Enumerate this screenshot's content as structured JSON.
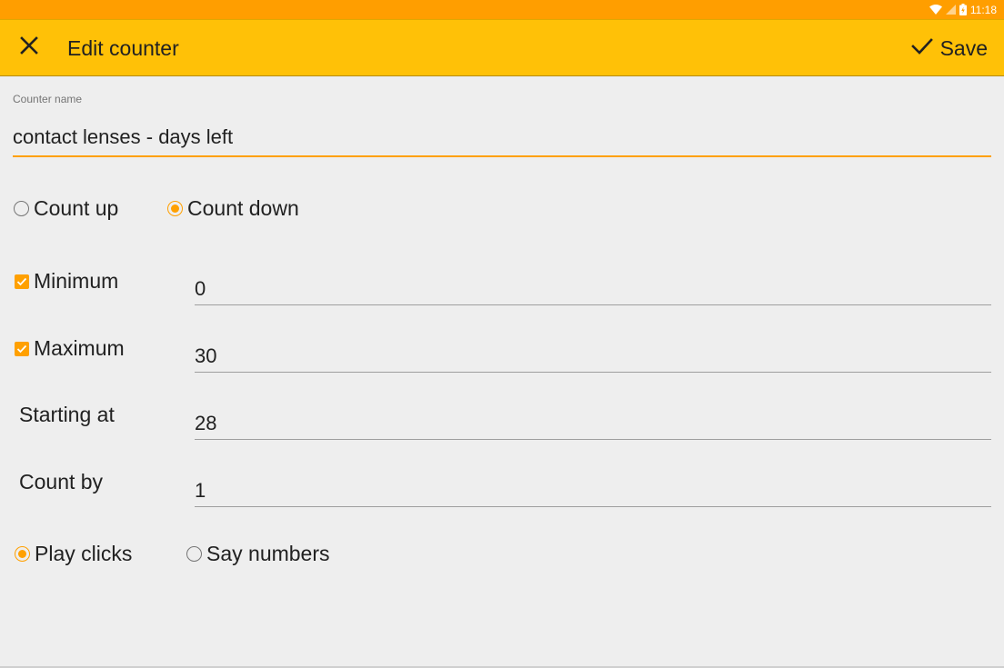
{
  "status_bar": {
    "time": "11:18",
    "icons": [
      "wifi-icon",
      "cell-signal-icon",
      "battery-charging-icon"
    ]
  },
  "app_bar": {
    "close_icon": "close-icon",
    "title": "Edit counter",
    "save_label": "Save",
    "save_icon": "check-icon",
    "color": "#ffc107"
  },
  "form": {
    "name_label": "Counter name",
    "name_value": "contact lenses - days left",
    "direction": {
      "count_up": "Count up",
      "count_down": "Count down",
      "selected": "Count down"
    },
    "minimum": {
      "label": "Minimum",
      "checked": true,
      "value": "0"
    },
    "maximum": {
      "label": "Maximum",
      "checked": true,
      "value": "30"
    },
    "starting_at": {
      "label": "Starting at",
      "value": "28"
    },
    "count_by": {
      "label": "Count by",
      "value": "1"
    },
    "sound": {
      "play_clicks": "Play clicks",
      "say_numbers": "Say numbers",
      "selected": "Play clicks"
    }
  },
  "colors": {
    "accent": "#ffa000",
    "status_bar": "#ff9e00",
    "background": "#eeeeee"
  }
}
